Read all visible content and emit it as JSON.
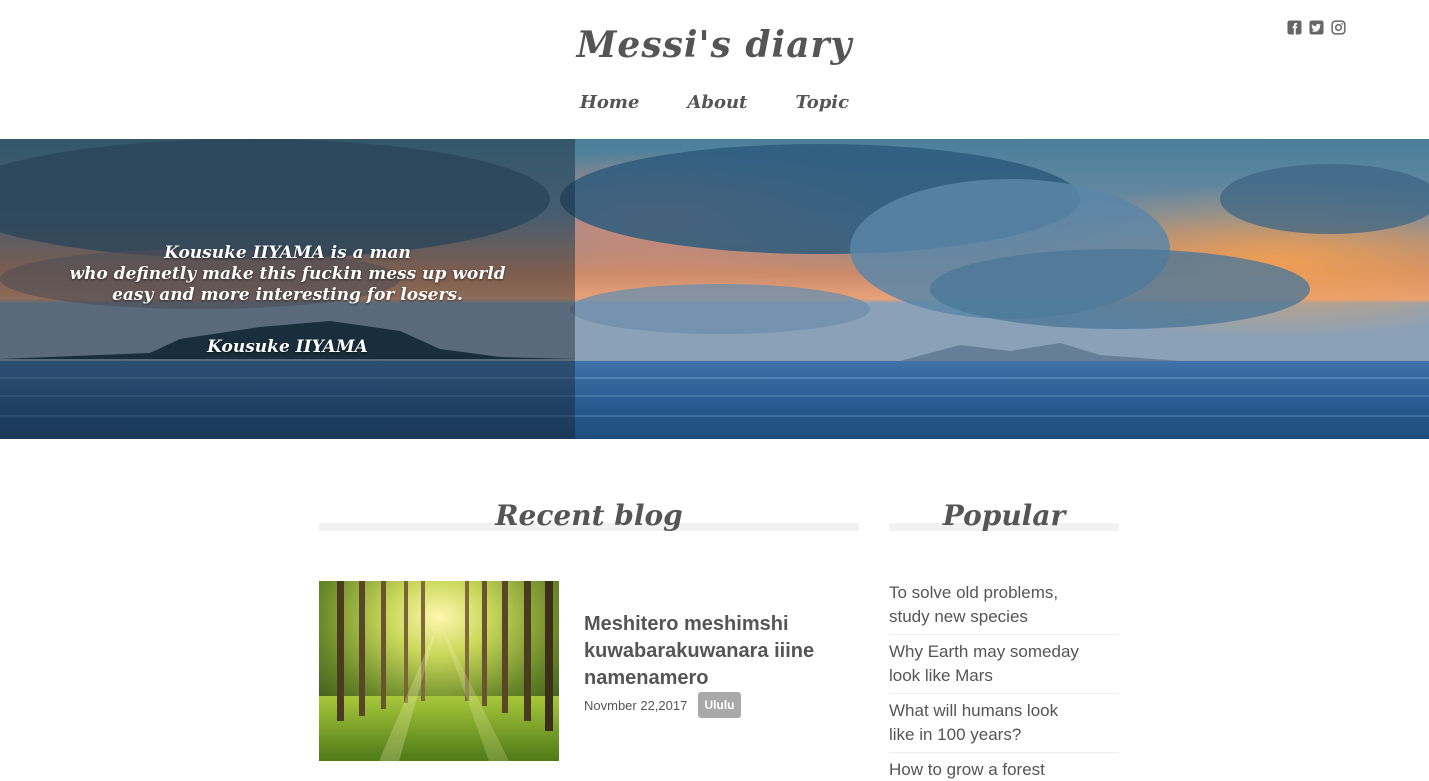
{
  "header": {
    "site_title": "Messi's diary",
    "nav": [
      "Home",
      "About",
      "Topic"
    ],
    "social_icons": [
      "facebook-icon",
      "twitter-icon",
      "instagram-icon"
    ]
  },
  "hero": {
    "quote_lines": [
      "Kousuke IIYAMA is a man",
      "who definetly make this fuckin mess up world",
      "easy and more interesting for losers."
    ],
    "quote_author": "Kousuke IIYAMA"
  },
  "recent": {
    "title": "Recent blog",
    "post": {
      "title": "Meshitero meshimshi kuwabarakuwanara iiine namenamero",
      "date": "Novmber 22,2017",
      "tag": "Ululu"
    }
  },
  "popular": {
    "title": "Popular",
    "items": [
      [
        "To solve old problems,",
        "study new species"
      ],
      [
        "Why Earth may someday",
        "look like Mars"
      ],
      [
        "What will humans look",
        "like in 100 years?"
      ],
      [
        "How to grow a forest",
        ""
      ]
    ]
  },
  "colors": {
    "text": "#555555",
    "tag_bg": "#a9a9a9",
    "rule": "#f2f2f2"
  }
}
